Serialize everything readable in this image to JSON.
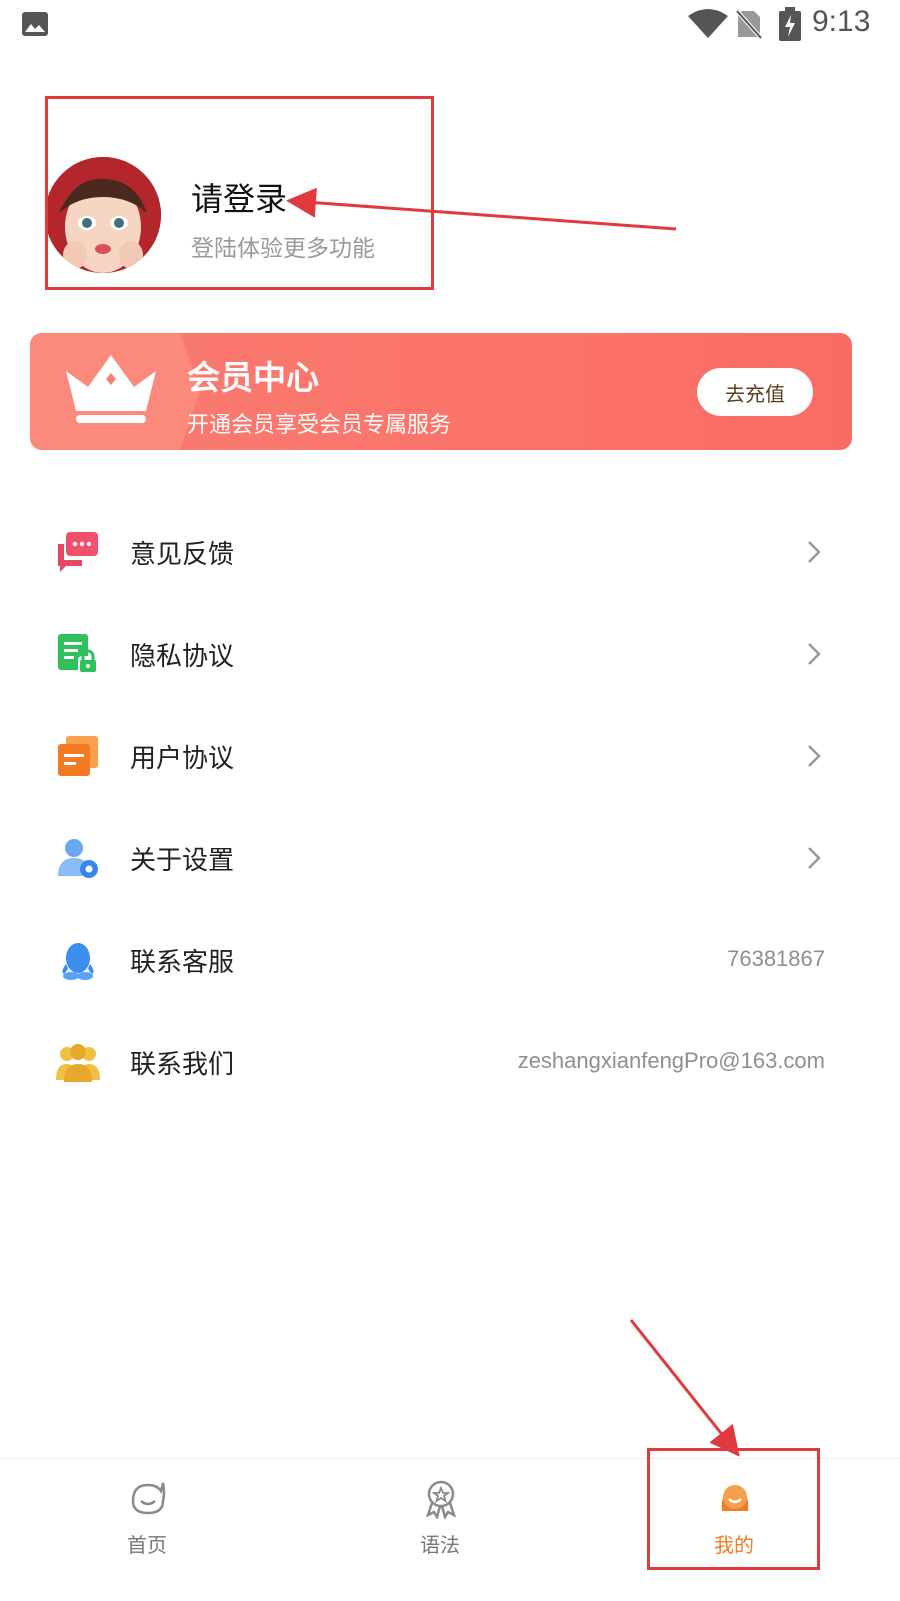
{
  "status_bar": {
    "time": "9:13",
    "icons": [
      "image-notification-icon",
      "wifi-icon",
      "no-sim-icon",
      "battery-charging-icon"
    ]
  },
  "profile": {
    "title": "请登录",
    "subtitle": "登陆体验更多功能",
    "avatar": "avatar"
  },
  "vip": {
    "title": "会员中心",
    "description": "开通会员享受会员专属服务",
    "button_label": "去充值",
    "icon": "crown-icon",
    "colors": {
      "banner": "#fb7369",
      "button_text": "#5b3f1e"
    }
  },
  "menu": {
    "items": [
      {
        "label": "意见反馈",
        "icon": "feedback-icon",
        "chevron": true
      },
      {
        "label": "隐私协议",
        "icon": "privacy-icon",
        "chevron": true
      },
      {
        "label": "用户协议",
        "icon": "user-agreement-icon",
        "chevron": true
      },
      {
        "label": "关于设置",
        "icon": "settings-icon",
        "chevron": true
      },
      {
        "label": "联系客服",
        "icon": "qq-icon",
        "value": "76381867"
      },
      {
        "label": "联系我们",
        "icon": "contact-group-icon",
        "value": "zeshangxianfengPro@163.com"
      }
    ]
  },
  "tabbar": {
    "tabs": [
      {
        "label": "首页",
        "icon": "home-icon",
        "active": false
      },
      {
        "label": "语法",
        "icon": "grammar-icon",
        "active": false
      },
      {
        "label": "我的",
        "icon": "profile-icon",
        "active": true
      }
    ],
    "colors": {
      "active": "#f07d26",
      "inactive": "#777777"
    }
  },
  "annotation_color": "#e0393e"
}
